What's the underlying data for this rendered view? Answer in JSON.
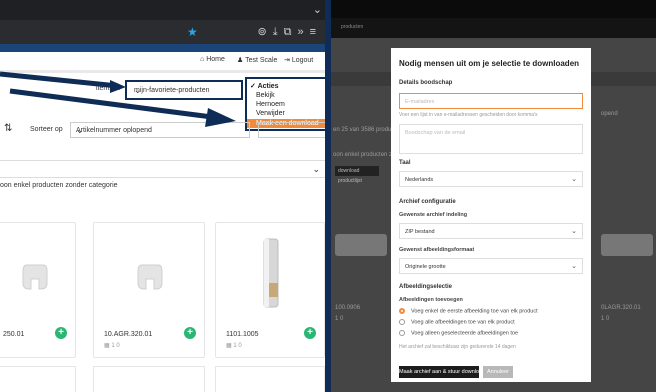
{
  "left": {
    "header_nav": {
      "home": "Home",
      "user": "Test Scale",
      "logout": "Logout"
    },
    "filter": {
      "label_fragment": "items in",
      "selected_list": "mijn-favoriete-producten"
    },
    "actions_menu": {
      "title": "Acties",
      "items": [
        "Bekijk",
        "Hernoem",
        "Verwijder",
        "Maak een download"
      ]
    },
    "sort": {
      "label": "Sorteer op",
      "value": "Artikelnummer oplopend"
    },
    "no_category_text": "oon enkel producten zonder categorie",
    "cards": [
      {
        "code": "250.01",
        "meta": "1 0"
      },
      {
        "code": "10.AGR.320.01",
        "meta": "1 0"
      },
      {
        "code": "1101.1005",
        "meta": "1 0"
      }
    ],
    "colors": {
      "navy": "#0e2c55",
      "accent_orange": "#f08a3c",
      "add_green": "#2bb673"
    }
  },
  "right": {
    "breadcrumb": "producten",
    "background_texts": {
      "left_line1": "en 25 van 3586 produc",
      "left_line2": "oon enkel producten z",
      "left_btn": "download productlijst",
      "right_line1": "opend",
      "left_code": "100.0906",
      "left_meta": "1 0",
      "right_code": "0LAGR.320.01",
      "right_meta": "1 0"
    },
    "modal": {
      "title": "Nodig mensen uit om je selectie te downloaden",
      "details_section": "Details boodschap",
      "email_placeholder": "E-mailadres",
      "email_help": "Voer een lijst in van e-mailadressen gescheiden door komma's",
      "message_placeholder": "Boodschap van de email",
      "language_section": "Taal",
      "language_value": "Nederlands",
      "archive_section": "Archief configuratie",
      "archive_layout_label": "Gewenste archief indeling",
      "archive_layout_value": "ZIP bestand",
      "image_format_label": "Gewenst afbeeldingsformaat",
      "image_format_value": "Originele grootte",
      "image_selection_section": "Afbeeldingselectie",
      "add_images_label": "Afbeeldingen toevoegen",
      "radio_options": [
        "Voeg enkel de eerste afbeelding toe van elk product",
        "Voeg alle afbeeldingen toe van elk product",
        "Voeg alleen geselecteerde afbeeldingen toe"
      ],
      "selected_radio": 0,
      "archive_note": "Het archief zal beschikbaar zijn gedurende 14 dagen",
      "primary_button": "Maak archief aan & stuur download link",
      "secondary_button": "Annuleer"
    }
  }
}
